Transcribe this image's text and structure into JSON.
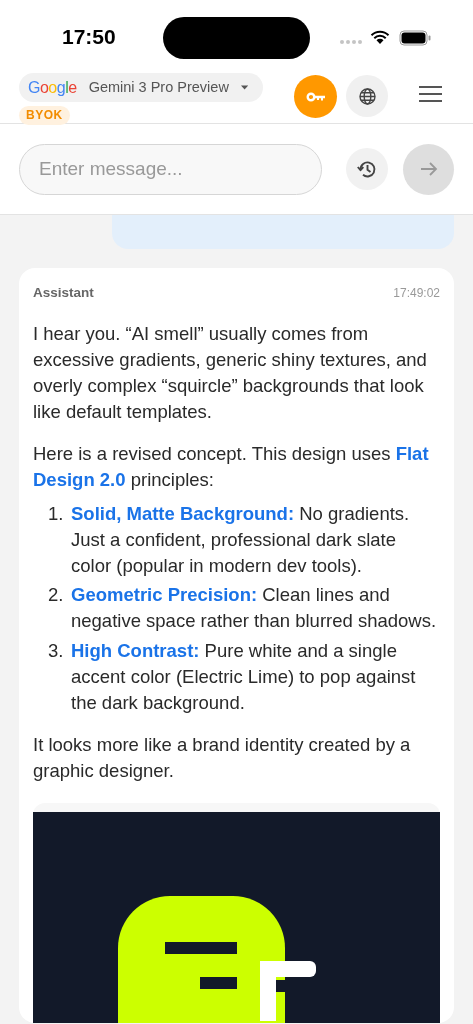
{
  "status_bar": {
    "time": "17:50"
  },
  "header": {
    "provider_logo": "Google",
    "model": "Gemini 3 Pro Preview",
    "badge": "BYOK",
    "key_button": {
      "active": true
    }
  },
  "composer": {
    "placeholder": "Enter message...",
    "send_disabled": true
  },
  "message": {
    "role": "Assistant",
    "time": "17:49:02",
    "paragraphs": [
      "I hear you. “AI smell” usually comes from excessive gradients, generic shiny textures, and overly complex “squircle” backgrounds that look like default templates.",
      "Here is a revised concept. This design uses **Flat Design 2.0** principles:"
    ],
    "list": [
      {
        "number": "1.",
        "text": "**Solid, Matte Background:** No gradients. Just a confident, professional dark slate color (popular in modern dev tools)."
      },
      {
        "number": "2.",
        "text": "**Geometric Precision:** Clean lines and negative space rather than blurred shadows."
      },
      {
        "number": "3.",
        "text": "**High Contrast:** Pure white and a single accent color (Electric Lime) to pop against the dark background."
      }
    ],
    "closing": "It looks more like a brand identity created by a graphic designer.",
    "attachment": {
      "kind": "picture"
    }
  }
}
